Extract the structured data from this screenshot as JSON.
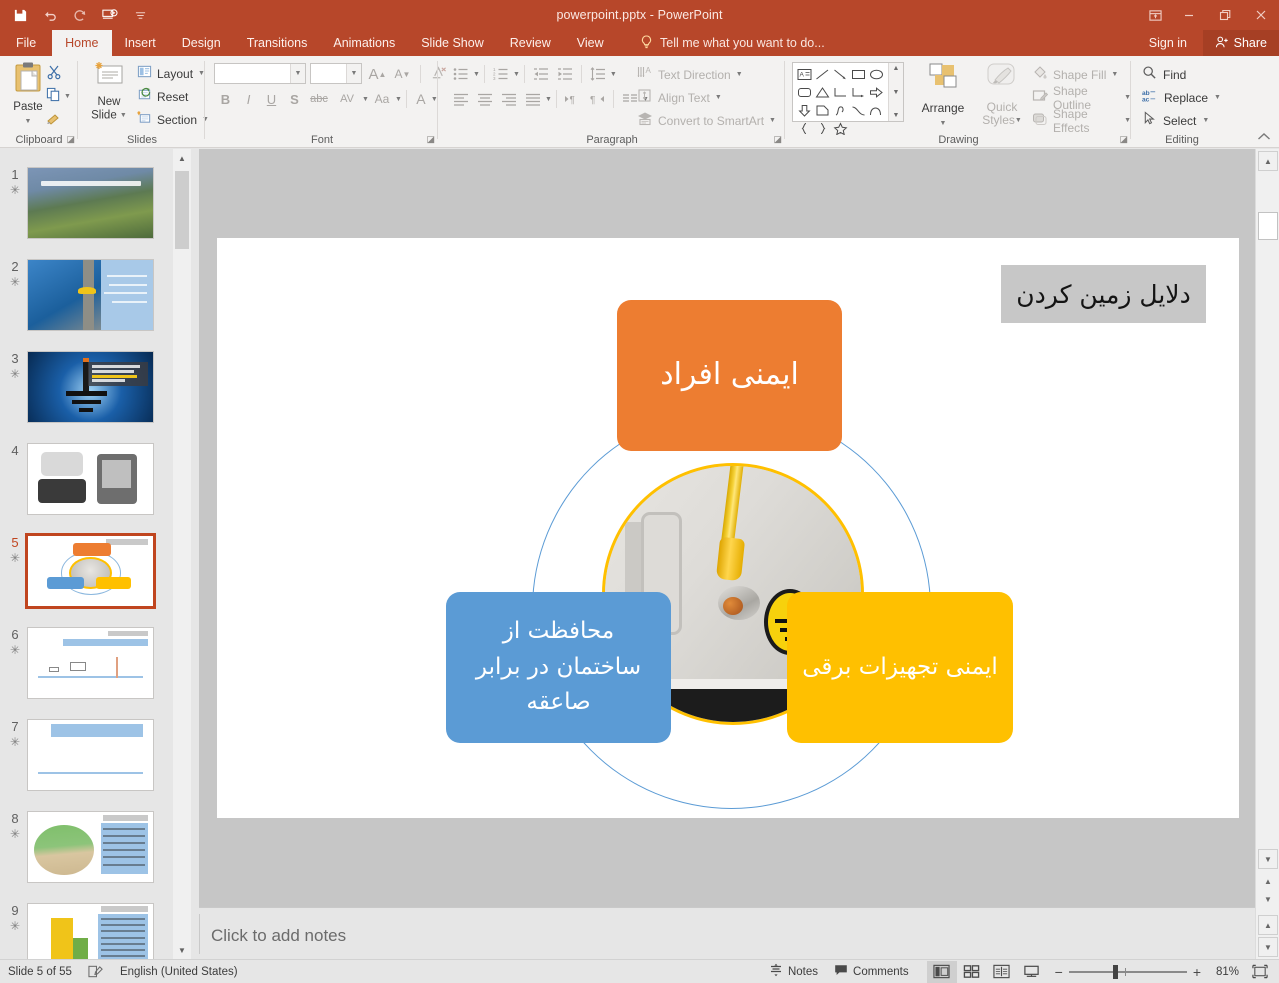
{
  "window": {
    "title": "powerpoint.pptx - PowerPoint",
    "quick_access": [
      {
        "name": "save-icon",
        "label": "Save"
      },
      {
        "name": "undo-icon",
        "label": "Undo"
      },
      {
        "name": "redo-icon",
        "label": "Redo"
      },
      {
        "name": "start-presentation-icon",
        "label": "Start From Beginning"
      },
      {
        "name": "customize-qat-icon",
        "label": "Customize Quick Access Toolbar"
      }
    ],
    "controls": [
      {
        "name": "ribbon-display-options-icon",
        "glyph": "❐"
      },
      {
        "name": "minimize-button",
        "glyph": "—"
      },
      {
        "name": "restore-button",
        "glyph": "❐"
      },
      {
        "name": "close-button",
        "glyph": "✕"
      }
    ],
    "accent_color": "#b7472a"
  },
  "tabs": [
    {
      "label": "File",
      "active": false
    },
    {
      "label": "Home",
      "active": true
    },
    {
      "label": "Insert",
      "active": false
    },
    {
      "label": "Design",
      "active": false
    },
    {
      "label": "Transitions",
      "active": false
    },
    {
      "label": "Animations",
      "active": false
    },
    {
      "label": "Slide Show",
      "active": false
    },
    {
      "label": "Review",
      "active": false
    },
    {
      "label": "View",
      "active": false
    }
  ],
  "tellme": {
    "placeholder": "Tell me what you want to do...",
    "icon": "lightbulb-icon"
  },
  "account": {
    "signin": "Sign in",
    "share": "Share"
  },
  "ribbon": {
    "clipboard": {
      "label": "Clipboard",
      "paste": "Paste",
      "cut": "Cut",
      "copy": "Copy",
      "format_painter": "Format Painter"
    },
    "slides": {
      "label": "Slides",
      "new_slide": "New\nSlide",
      "new_slide_line1": "New",
      "new_slide_line2": "Slide",
      "layout": "Layout",
      "reset": "Reset",
      "section": "Section"
    },
    "font": {
      "label": "Font",
      "font_family_value": "",
      "font_size_value": "",
      "increase_size": "A",
      "decrease_size": "A",
      "clear_formatting": "Clear All Formatting",
      "bold": "B",
      "italic": "I",
      "underline": "U",
      "shadow": "S",
      "strikethrough": "abc",
      "character_spacing": "AV",
      "change_case": "Aa",
      "font_color": "A"
    },
    "paragraph": {
      "label": "Paragraph",
      "text_direction": "Text Direction",
      "align_text": "Align Text",
      "convert_to_smartart": "Convert to SmartArt"
    },
    "drawing": {
      "label": "Drawing",
      "arrange": "Arrange",
      "quick_styles_line1": "Quick",
      "quick_styles_line2": "Styles",
      "shape_fill": "Shape Fill",
      "shape_outline": "Shape Outline",
      "shape_effects": "Shape Effects"
    },
    "editing": {
      "label": "Editing",
      "find": "Find",
      "replace": "Replace",
      "select": "Select"
    },
    "collapse": "Collapse the Ribbon"
  },
  "thumbnails": [
    {
      "num": "1",
      "star": "✳",
      "kind": "t1",
      "selected": false
    },
    {
      "num": "2",
      "star": "✳",
      "kind": "t2",
      "selected": false
    },
    {
      "num": "3",
      "star": "✳",
      "kind": "t3",
      "selected": false
    },
    {
      "num": "4",
      "star": "",
      "kind": "t4",
      "selected": false
    },
    {
      "num": "5",
      "star": "✳",
      "kind": "t5",
      "selected": true
    },
    {
      "num": "6",
      "star": "✳",
      "kind": "t6",
      "selected": false
    },
    {
      "num": "7",
      "star": "✳",
      "kind": "t7",
      "selected": false
    },
    {
      "num": "8",
      "star": "✳",
      "kind": "t8",
      "selected": false
    },
    {
      "num": "9",
      "star": "✳",
      "kind": "t9",
      "selected": false
    }
  ],
  "slide": {
    "title": "دلایل زمین کردن",
    "title_bg": "#c7c7c7",
    "boxes": [
      {
        "name": "orange",
        "text": "ایمنی افراد",
        "color": "#ed7d31"
      },
      {
        "name": "blue",
        "text": "محافظت از ساختمان در برابر صاعقه",
        "color": "#5b9bd5"
      },
      {
        "name": "yellow",
        "text": "ایمنی تجهیزات برقی",
        "color": "#ffc000"
      }
    ],
    "center_image": "grounding-terminal-photo",
    "ring_color": "#5b9bd5"
  },
  "notes": {
    "placeholder": "Click to add notes"
  },
  "statusbar": {
    "slide_counter": "Slide 5 of 55",
    "language": "English (United States)",
    "spellcheck_icon": "spellcheck-icon",
    "notes": "Notes",
    "comments": "Comments",
    "views": [
      {
        "name": "normal-view",
        "active": true
      },
      {
        "name": "slide-sorter-view",
        "active": false
      },
      {
        "name": "reading-view",
        "active": false
      },
      {
        "name": "slide-show-view",
        "active": false
      }
    ],
    "zoom_out": "−",
    "zoom_in": "+",
    "zoom_level": "81%",
    "fit_to_window": "fit-slide-icon"
  }
}
